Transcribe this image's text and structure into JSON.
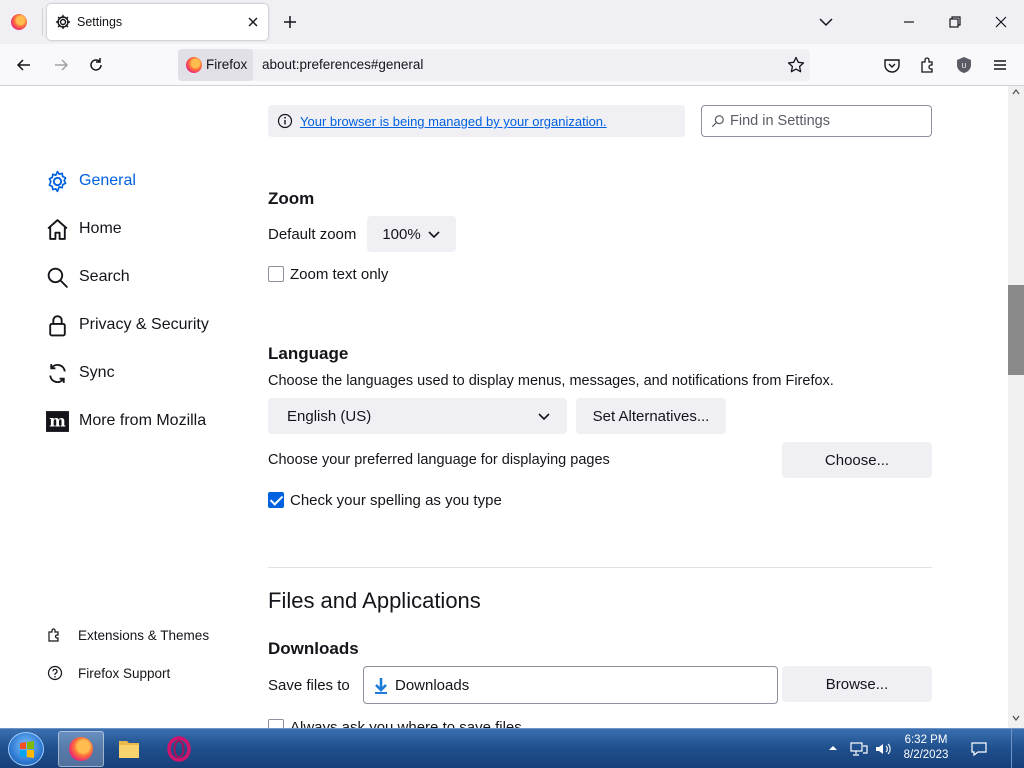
{
  "browser": {
    "tab_title": "Settings",
    "identity_label": "Firefox",
    "url": "about:preferences#general"
  },
  "sidebar": {
    "categories": [
      {
        "label": "General",
        "icon": "gear-icon",
        "selected": true
      },
      {
        "label": "Home",
        "icon": "home-icon",
        "selected": false
      },
      {
        "label": "Search",
        "icon": "search-icon",
        "selected": false
      },
      {
        "label": "Privacy & Security",
        "icon": "lock-icon",
        "selected": false
      },
      {
        "label": "Sync",
        "icon": "sync-icon",
        "selected": false
      },
      {
        "label": "More from Mozilla",
        "icon": "mozilla-icon",
        "selected": false
      }
    ],
    "footer": [
      {
        "label": "Extensions & Themes",
        "icon": "puzzle-icon"
      },
      {
        "label": "Firefox Support",
        "icon": "help-icon"
      }
    ]
  },
  "header": {
    "policies_link": "Your browser is being managed by your organization.",
    "search_placeholder": "Find in Settings"
  },
  "zoom": {
    "heading": "Zoom",
    "default_zoom_label": "Default zoom",
    "default_zoom_value": "100%",
    "zoom_text_only_label": "Zoom text only",
    "zoom_text_only_checked": false
  },
  "language": {
    "heading": "Language",
    "description": "Choose the languages used to display menus, messages, and notifications from Firefox.",
    "selected_language": "English (US)",
    "set_alternatives_label": "Set Alternatives...",
    "page_language_label": "Choose your preferred language for displaying pages",
    "choose_label": "Choose...",
    "spellcheck_label": "Check your spelling as you type",
    "spellcheck_checked": true
  },
  "files": {
    "group_heading": "Files and Applications",
    "downloads_heading": "Downloads",
    "save_files_label": "Save files to",
    "save_folder": "Downloads",
    "browse_label": "Browse...",
    "always_ask_label": "Always ask you where to save files"
  },
  "taskbar": {
    "time": "6:32 PM",
    "date": "8/2/2023"
  },
  "colors": {
    "accent": "#0061e0",
    "taskbar": "#1f4f8c"
  }
}
